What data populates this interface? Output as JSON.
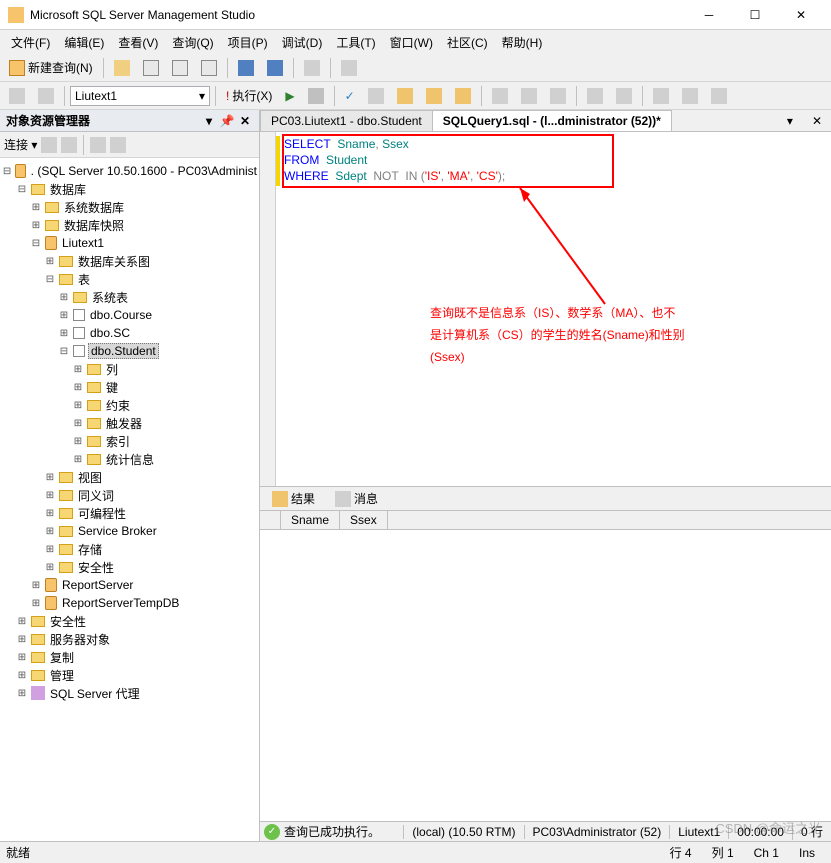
{
  "window": {
    "title": "Microsoft SQL Server Management Studio"
  },
  "menu": {
    "file": "文件(F)",
    "edit": "编辑(E)",
    "view": "查看(V)",
    "query": "查询(Q)",
    "project": "项目(P)",
    "debug": "调试(D)",
    "tools": "工具(T)",
    "window": "窗口(W)",
    "community": "社区(C)",
    "help": "帮助(H)"
  },
  "toolbar": {
    "new_query": "新建查询(N)",
    "db_selected": "Liutext1",
    "execute": "执行(X)"
  },
  "panel": {
    "title": "对象资源管理器",
    "connect": "连接 ▾"
  },
  "tree": {
    "server": ". (SQL Server 10.50.1600 - PC03\\Administ",
    "databases": "数据库",
    "sysdb": "系统数据库",
    "snapshots": "数据库快照",
    "liutext1": "Liutext1",
    "diagrams": "数据库关系图",
    "tables": "表",
    "systables": "系统表",
    "course": "dbo.Course",
    "sc": "dbo.SC",
    "student": "dbo.Student",
    "columns": "列",
    "keys": "键",
    "constraints": "约束",
    "triggers": "触发器",
    "indexes": "索引",
    "stats": "统计信息",
    "views": "视图",
    "synonyms": "同义词",
    "programmability": "可编程性",
    "servicebroker": "Service Broker",
    "storage": "存储",
    "security_db": "安全性",
    "reportserver": "ReportServer",
    "reportservertemp": "ReportServerTempDB",
    "security": "安全性",
    "serverobjects": "服务器对象",
    "replication": "复制",
    "management": "管理",
    "agent": "SQL Server 代理"
  },
  "tabs": {
    "tab1": "PC03.Liutext1 - dbo.Student",
    "tab2": "SQLQuery1.sql - (l...dministrator (52))*"
  },
  "sql": {
    "select": "SELECT",
    "sname": "Sname",
    "ssex": "Ssex",
    "from": "FROM",
    "student": "Student",
    "where": "WHERE",
    "sdept": "Sdept",
    "not": "NOT",
    "in": "IN",
    "is": "'IS'",
    "ma": "'MA'",
    "cs": "'CS'"
  },
  "annotation": {
    "line1": "查询既不是信息系（IS）、数学系（MA）、也不",
    "line2": "是计算机系（CS）的学生的姓名(Sname)和性别",
    "line3": "(Ssex)"
  },
  "results": {
    "tab_results": "结果",
    "tab_messages": "消息",
    "col1": "Sname",
    "col2": "Ssex"
  },
  "status_query": {
    "ok": "查询已成功执行。",
    "server": "(local) (10.50 RTM)",
    "user": "PC03\\Administrator (52)",
    "db": "Liutext1",
    "time": "00:00:00",
    "rows": "0 行"
  },
  "status_app": {
    "ready": "就绪",
    "line": "行 4",
    "col": "列 1",
    "ch": "Ch 1",
    "ins": "Ins"
  },
  "watermark": "CSDN @命运之光"
}
